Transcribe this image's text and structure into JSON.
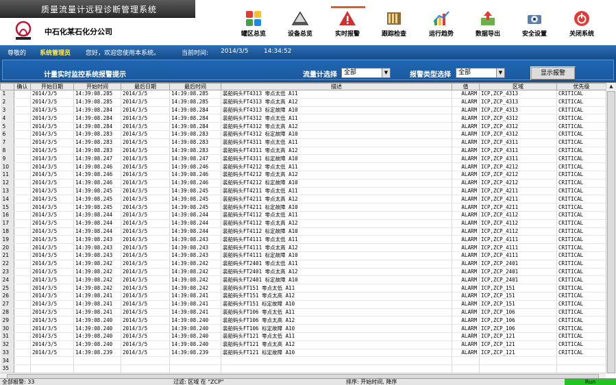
{
  "app": {
    "title": "质量流量计远程诊断管理系统",
    "company": "中石化某石化分公司"
  },
  "toolbar": [
    {
      "label": "罐区总览",
      "icon": "tank-area-icon"
    },
    {
      "label": "设备总览",
      "icon": "equipment-icon"
    },
    {
      "label": "实时报警",
      "icon": "alarm-warning-icon",
      "active": true
    },
    {
      "label": "跟踪检查",
      "icon": "tracking-icon"
    },
    {
      "label": "运行趋势",
      "icon": "trend-chart-icon"
    },
    {
      "label": "数据导出",
      "icon": "export-icon"
    },
    {
      "label": "安全设置",
      "icon": "security-icon"
    },
    {
      "label": "关闭系统",
      "icon": "power-icon"
    }
  ],
  "infobar": {
    "greeting": "尊敬的",
    "user": "系统管理员",
    "welcome": "您好，欢迎您使用本系统。",
    "time_label": "当前时间:",
    "date": "2014/3/5",
    "time": "14:34:52"
  },
  "filter": {
    "panel_title": "计量实时监控系统报警提示",
    "meter_label": "流量计选择",
    "meter_value": "全部",
    "type_label": "报警类型选择",
    "type_value": "全部",
    "show_button": "显示报警"
  },
  "table": {
    "columns": [
      "确认",
      "开始日期",
      "开始时间",
      "最后日期",
      "最后时间",
      "描述",
      "值",
      "区域",
      "优先级"
    ],
    "rows": [
      [
        "",
        "2014/3/5",
        "14:39:08.285",
        "2014/3/5",
        "14:39:08.285",
        "装船码头FT4313 零点太低 A11",
        "ALARM",
        "ICP,ZCP_4313",
        "CRITICAL"
      ],
      [
        "",
        "2014/3/5",
        "14:39:08.285",
        "2014/3/5",
        "14:39:08.285",
        "装船码头FT4313 零点太高 A12",
        "ALARM",
        "ICP,ZCP_4313",
        "CRITICAL"
      ],
      [
        "",
        "2014/3/5",
        "14:39:08.284",
        "2014/3/5",
        "14:39:08.284",
        "装船码头FT4313 标定故障 A10",
        "ALARM",
        "ICP,ZCP_4313",
        "CRITICAL"
      ],
      [
        "",
        "2014/3/5",
        "14:39:08.284",
        "2014/3/5",
        "14:39:08.284",
        "装船码头FT4312 零点太低 A11",
        "ALARM",
        "ICP,ZCP_4312",
        "CRITICAL"
      ],
      [
        "",
        "2014/3/5",
        "14:39:08.284",
        "2014/3/5",
        "14:39:08.284",
        "装船码头FT4312 零点太高 A12",
        "ALARM",
        "ICP,ZCP_4312",
        "CRITICAL"
      ],
      [
        "",
        "2014/3/5",
        "14:39:08.283",
        "2014/3/5",
        "14:39:08.283",
        "装船码头FT4312 标定故障 A10",
        "ALARM",
        "ICP,ZCP_4312",
        "CRITICAL"
      ],
      [
        "",
        "2014/3/5",
        "14:39:08.283",
        "2014/3/5",
        "14:39:08.283",
        "装船码头FT4311 零点太低 A11",
        "ALARM",
        "ICP,ZCP_4311",
        "CRITICAL"
      ],
      [
        "",
        "2014/3/5",
        "14:39:08.283",
        "2014/3/5",
        "14:39:08.283",
        "装船码头FT4311 零点太高 A12",
        "ALARM",
        "ICP,ZCP_4311",
        "CRITICAL"
      ],
      [
        "",
        "2014/3/5",
        "14:39:08.247",
        "2014/3/5",
        "14:39:08.247",
        "装船码头FT4311 标定故障 A10",
        "ALARM",
        "ICP,ZCP_4311",
        "CRITICAL"
      ],
      [
        "",
        "2014/3/5",
        "14:39:08.246",
        "2014/3/5",
        "14:39:08.246",
        "装船码头FT4212 零点太低 A11",
        "ALARM",
        "ICP,ZCP_4212",
        "CRITICAL"
      ],
      [
        "",
        "2014/3/5",
        "14:39:08.246",
        "2014/3/5",
        "14:39:08.246",
        "装船码头FT4212 零点太高 A12",
        "ALARM",
        "ICP,ZCP_4212",
        "CRITICAL"
      ],
      [
        "",
        "2014/3/5",
        "14:39:08.246",
        "2014/3/5",
        "14:39:08.246",
        "装船码头FT4212 标定故障 A10",
        "ALARM",
        "ICP,ZCP_4212",
        "CRITICAL"
      ],
      [
        "",
        "2014/3/5",
        "14:39:08.245",
        "2014/3/5",
        "14:39:08.245",
        "装船码头FT4211 零点太低 A11",
        "ALARM",
        "ICP,ZCP_4211",
        "CRITICAL"
      ],
      [
        "",
        "2014/3/5",
        "14:39:08.245",
        "2014/3/5",
        "14:39:08.245",
        "装船码头FT4211 零点太高 A12",
        "ALARM",
        "ICP,ZCP_4211",
        "CRITICAL"
      ],
      [
        "",
        "2014/3/5",
        "14:39:08.245",
        "2014/3/5",
        "14:39:08.245",
        "装船码头FT4211 标定故障 A10",
        "ALARM",
        "ICP,ZCP_4211",
        "CRITICAL"
      ],
      [
        "",
        "2014/3/5",
        "14:39:08.244",
        "2014/3/5",
        "14:39:08.244",
        "装船码头FT4112 零点太低 A11",
        "ALARM",
        "ICP,ZCP_4112",
        "CRITICAL"
      ],
      [
        "",
        "2014/3/5",
        "14:39:08.244",
        "2014/3/5",
        "14:39:08.244",
        "装船码头FT4112 零点太高 A12",
        "ALARM",
        "ICP,ZCP_4112",
        "CRITICAL"
      ],
      [
        "",
        "2014/3/5",
        "14:39:08.244",
        "2014/3/5",
        "14:39:08.244",
        "装船码头FT4112 标定故障 A10",
        "ALARM",
        "ICP,ZCP_4112",
        "CRITICAL"
      ],
      [
        "",
        "2014/3/5",
        "14:39:08.243",
        "2014/3/5",
        "14:39:08.243",
        "装船码头FT4111 零点太低 A11",
        "ALARM",
        "ICP,ZCP_4111",
        "CRITICAL"
      ],
      [
        "",
        "2014/3/5",
        "14:39:08.243",
        "2014/3/5",
        "14:39:08.243",
        "装船码头FT4111 零点太高 A12",
        "ALARM",
        "ICP,ZCP_4111",
        "CRITICAL"
      ],
      [
        "",
        "2014/3/5",
        "14:39:08.243",
        "2014/3/5",
        "14:39:08.243",
        "装船码头FT4111 标定故障 A10",
        "ALARM",
        "ICP,ZCP_4111",
        "CRITICAL"
      ],
      [
        "",
        "2014/3/5",
        "14:39:08.242",
        "2014/3/5",
        "14:39:08.242",
        "装船码头FT2401 零点太低 A11",
        "ALARM",
        "ICP,ZCP_2401",
        "CRITICAL"
      ],
      [
        "",
        "2014/3/5",
        "14:39:08.242",
        "2014/3/5",
        "14:39:08.242",
        "装船码头FT2401 零点太高 A12",
        "ALARM",
        "ICP,ZCP_2401",
        "CRITICAL"
      ],
      [
        "",
        "2014/3/5",
        "14:39:08.242",
        "2014/3/5",
        "14:39:08.242",
        "装船码头FT2401 标定故障 A10",
        "ALARM",
        "ICP,ZCP_2401",
        "CRITICAL"
      ],
      [
        "",
        "2014/3/5",
        "14:39:08.242",
        "2014/3/5",
        "14:39:08.242",
        "装船码头FT151 零点太低 A11",
        "ALARM",
        "ICP,ZCP_151",
        "CRITICAL"
      ],
      [
        "",
        "2014/3/5",
        "14:39:08.241",
        "2014/3/5",
        "14:39:08.241",
        "装船码头FT151 零点太高 A12",
        "ALARM",
        "ICP,ZCP_151",
        "CRITICAL"
      ],
      [
        "",
        "2014/3/5",
        "14:39:08.241",
        "2014/3/5",
        "14:39:08.241",
        "装船码头FT151 标定故障 A10",
        "ALARM",
        "ICP,ZCP_151",
        "CRITICAL"
      ],
      [
        "",
        "2014/3/5",
        "14:39:08.241",
        "2014/3/5",
        "14:39:08.241",
        "装船码头FT106 零点太低 A11",
        "ALARM",
        "ICP,ZCP_106",
        "CRITICAL"
      ],
      [
        "",
        "2014/3/5",
        "14:39:08.240",
        "2014/3/5",
        "14:39:08.240",
        "装船码头FT106 零点太高 A12",
        "ALARM",
        "ICP,ZCP_106",
        "CRITICAL"
      ],
      [
        "",
        "2014/3/5",
        "14:39:08.240",
        "2014/3/5",
        "14:39:08.240",
        "装船码头FT106 标定故障 A10",
        "ALARM",
        "ICP,ZCP_106",
        "CRITICAL"
      ],
      [
        "",
        "2014/3/5",
        "14:39:08.240",
        "2014/3/5",
        "14:39:08.240",
        "装船码头FT121 零点太低 A11",
        "ALARM",
        "ICP,ZCP_121",
        "CRITICAL"
      ],
      [
        "",
        "2014/3/5",
        "14:39:08.240",
        "2014/3/5",
        "14:39:08.240",
        "装船码头FT121 零点太高 A12",
        "ALARM",
        "ICP,ZCP_121",
        "CRITICAL"
      ],
      [
        "",
        "2014/3/5",
        "14:39:08.239",
        "2014/3/5",
        "14:39:08.239",
        "装船码头FT121 标定故障 A10",
        "ALARM",
        "ICP,ZCP_121",
        "CRITICAL"
      ]
    ],
    "row_numbers": [
      "1",
      "2",
      "3",
      "4",
      "5",
      "6",
      "7",
      "8",
      "9",
      "10",
      "11",
      "12",
      "13",
      "14",
      "15",
      "16",
      "17",
      "18",
      "19",
      "20",
      "21",
      "22",
      "23",
      "24",
      "25",
      "26",
      "27",
      "28",
      "29",
      "30",
      "31",
      "32",
      "33",
      "34",
      "35"
    ]
  },
  "status": {
    "count": "全部报警: 33",
    "filter": "过滤: 区域 在 \"ZCP\"",
    "sort": "排序: 开始时间, 降序",
    "run": "Run"
  },
  "colors": {
    "accent": "#16508e",
    "run": "#22c422",
    "user": "#ffe94f"
  }
}
